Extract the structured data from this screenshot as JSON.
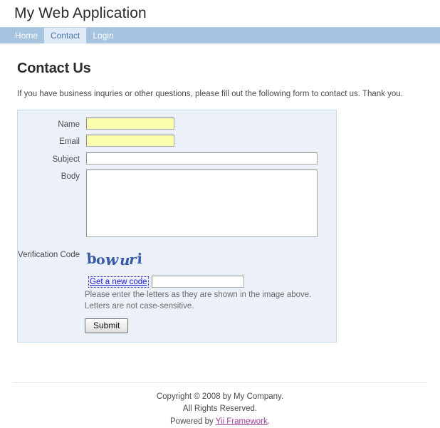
{
  "header": {
    "app_title": "My Web Application"
  },
  "nav": {
    "items": [
      {
        "label": "Home",
        "active": false
      },
      {
        "label": "Contact",
        "active": true
      },
      {
        "label": "Login",
        "active": false
      }
    ]
  },
  "main": {
    "page_title": "Contact Us",
    "intro_text": "If you have business inquries or other questions, please fill out the following form to contact us. Thank you."
  },
  "form": {
    "fields": {
      "name": {
        "label": "Name",
        "value": "",
        "placeholder": "",
        "required": true
      },
      "email": {
        "label": "Email",
        "value": "",
        "placeholder": "",
        "required": true
      },
      "subject": {
        "label": "Subject",
        "value": "",
        "placeholder": "",
        "required": false
      },
      "body": {
        "label": "Body",
        "value": "",
        "placeholder": "",
        "required": false
      },
      "verification": {
        "label": "Verification Code",
        "value": "",
        "placeholder": ""
      }
    },
    "captcha": {
      "text": "bowuri",
      "refresh_link": "Get a new code",
      "hint_line1": "Please enter the letters as they are shown in the image above.",
      "hint_line2": "Letters are not case-sensitive."
    },
    "submit_label": "Submit"
  },
  "footer": {
    "copyright": "Copyright © 2008 by My Company.",
    "rights": "All Rights Reserved.",
    "powered_prefix": "Powered by ",
    "powered_link": "Yii Framework",
    "powered_suffix": "."
  },
  "colors": {
    "nav_bar": "#a6c3e0",
    "nav_active_bg": "#dfeaf6",
    "nav_active_text": "#4c7aad",
    "panel_bg": "#ecf1f9",
    "panel_border": "#c3dcea",
    "required_field_bg": "#fcfcae",
    "link": "#2020d0",
    "visited_link": "#9d3d9d",
    "captcha_text": "#3a5ba8"
  }
}
